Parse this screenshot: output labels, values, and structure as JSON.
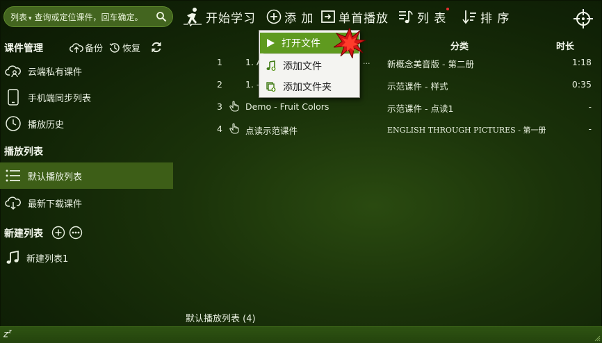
{
  "toolbar": {
    "search_scope": "列表",
    "search_placeholder": "查询或定位课件，回车确定。",
    "start_label": "开始学习",
    "add_label": "添 加",
    "single_play_label": "单首播放",
    "list_label": "列 表",
    "sort_label": "排 序"
  },
  "sidebar": {
    "courseware_head": "课件管理",
    "backup_label": "备份",
    "restore_label": "恢复",
    "items": [
      {
        "label": "云端私有课件",
        "icon": "cloud-user-icon"
      },
      {
        "label": "手机端同步列表",
        "icon": "phone-icon"
      },
      {
        "label": "播放历史",
        "icon": "clock-icon"
      }
    ],
    "playlist_head": "播放列表",
    "playlist_items": [
      {
        "label": "默认播放列表",
        "icon": "list-icon",
        "active": true
      },
      {
        "label": "最新下载课件",
        "icon": "cloud-download-icon",
        "active": false
      }
    ],
    "new_list_head": "新建列表",
    "new_lists": [
      {
        "label": "新建列表1",
        "icon": "music-note-icon"
      }
    ]
  },
  "table": {
    "headers": {
      "category": "分类",
      "duration": "时长"
    },
    "rows": [
      {
        "num": "1",
        "title": "1. A",
        "category": "新概念美音版 - 第二册",
        "duration": "1:18",
        "hand": false
      },
      {
        "num": "2",
        "title": "1. -",
        "category": "示范课件 - 样式",
        "duration": "0:35",
        "hand": false
      },
      {
        "num": "3",
        "title": "Demo - Fruit Colors",
        "category": "示范课件 - 点读1",
        "duration": "-",
        "hand": true
      },
      {
        "num": "4",
        "title": "点读示范课件",
        "category": "ENGLISH THROUGH PICTURES - 第一册",
        "duration": "-",
        "hand": true
      }
    ],
    "row1_truncation": "...",
    "footer": "默认播放列表 (4)"
  },
  "menu": {
    "items": [
      {
        "label": "打开文件",
        "icon": "play-triangle-icon",
        "highlighted": true
      },
      {
        "label": "添加文件",
        "icon": "add-file-icon",
        "highlighted": false
      },
      {
        "label": "添加文件夹",
        "icon": "add-folder-icon",
        "highlighted": false
      }
    ]
  },
  "statusbar": {
    "sleep_text": "zz"
  },
  "colors": {
    "accent": "#5f9a1f",
    "sidebar_active": "#3d5e17",
    "background_dark": "#112306",
    "red_marker": "#e63030"
  }
}
